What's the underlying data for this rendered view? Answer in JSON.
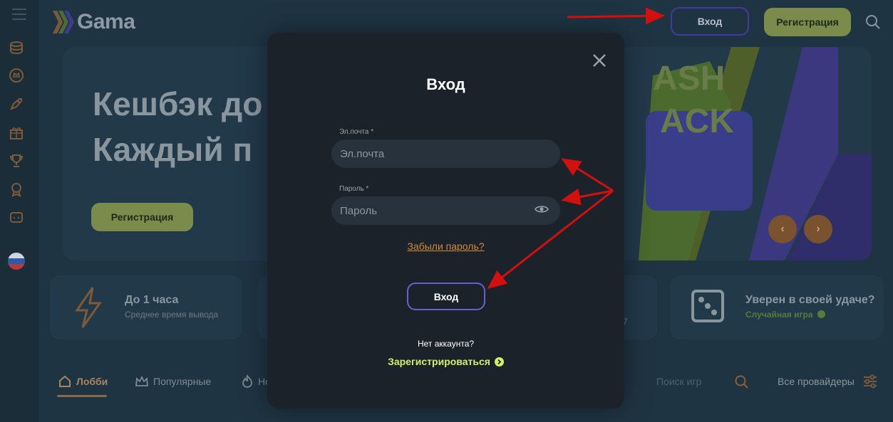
{
  "header": {
    "logo_text": "Gama",
    "login_label": "Вход",
    "register_label": "Регистрация"
  },
  "banner": {
    "title_line1": "Кешбэк до",
    "title_line2": "Каждый п",
    "register_label": "Регистрация"
  },
  "cards": {
    "payout_title": "До 1 часа",
    "payout_sub": "Среднее время вывода",
    "support_sub_fragment": "7",
    "luck_title": "Уверен в своей удаче?",
    "luck_sub": "Случайная игра"
  },
  "tabs": [
    {
      "label": "Лобби",
      "active": true
    },
    {
      "label": "Популярные",
      "active": false
    },
    {
      "label": "Но",
      "active": false
    }
  ],
  "games_search": {
    "placeholder": "Поиск игр"
  },
  "providers_label": "Все провайдеры",
  "modal": {
    "title": "Вход",
    "email_label": "Эл.почта *",
    "email_placeholder": "Эл.почта",
    "password_label": "Пароль *",
    "password_placeholder": "Пароль",
    "forgot_label": "Забыли пароль?",
    "login_label": "Вход",
    "no_account_text": "Нет аккаунта?",
    "register_label": "Зарегистрироваться"
  },
  "colors": {
    "accent_green": "#7a8b4b",
    "accent_purple": "#6b5fd0",
    "link_orange": "#d48a36",
    "link_lime": "#d4f06a",
    "annotation_red": "#d11010"
  }
}
